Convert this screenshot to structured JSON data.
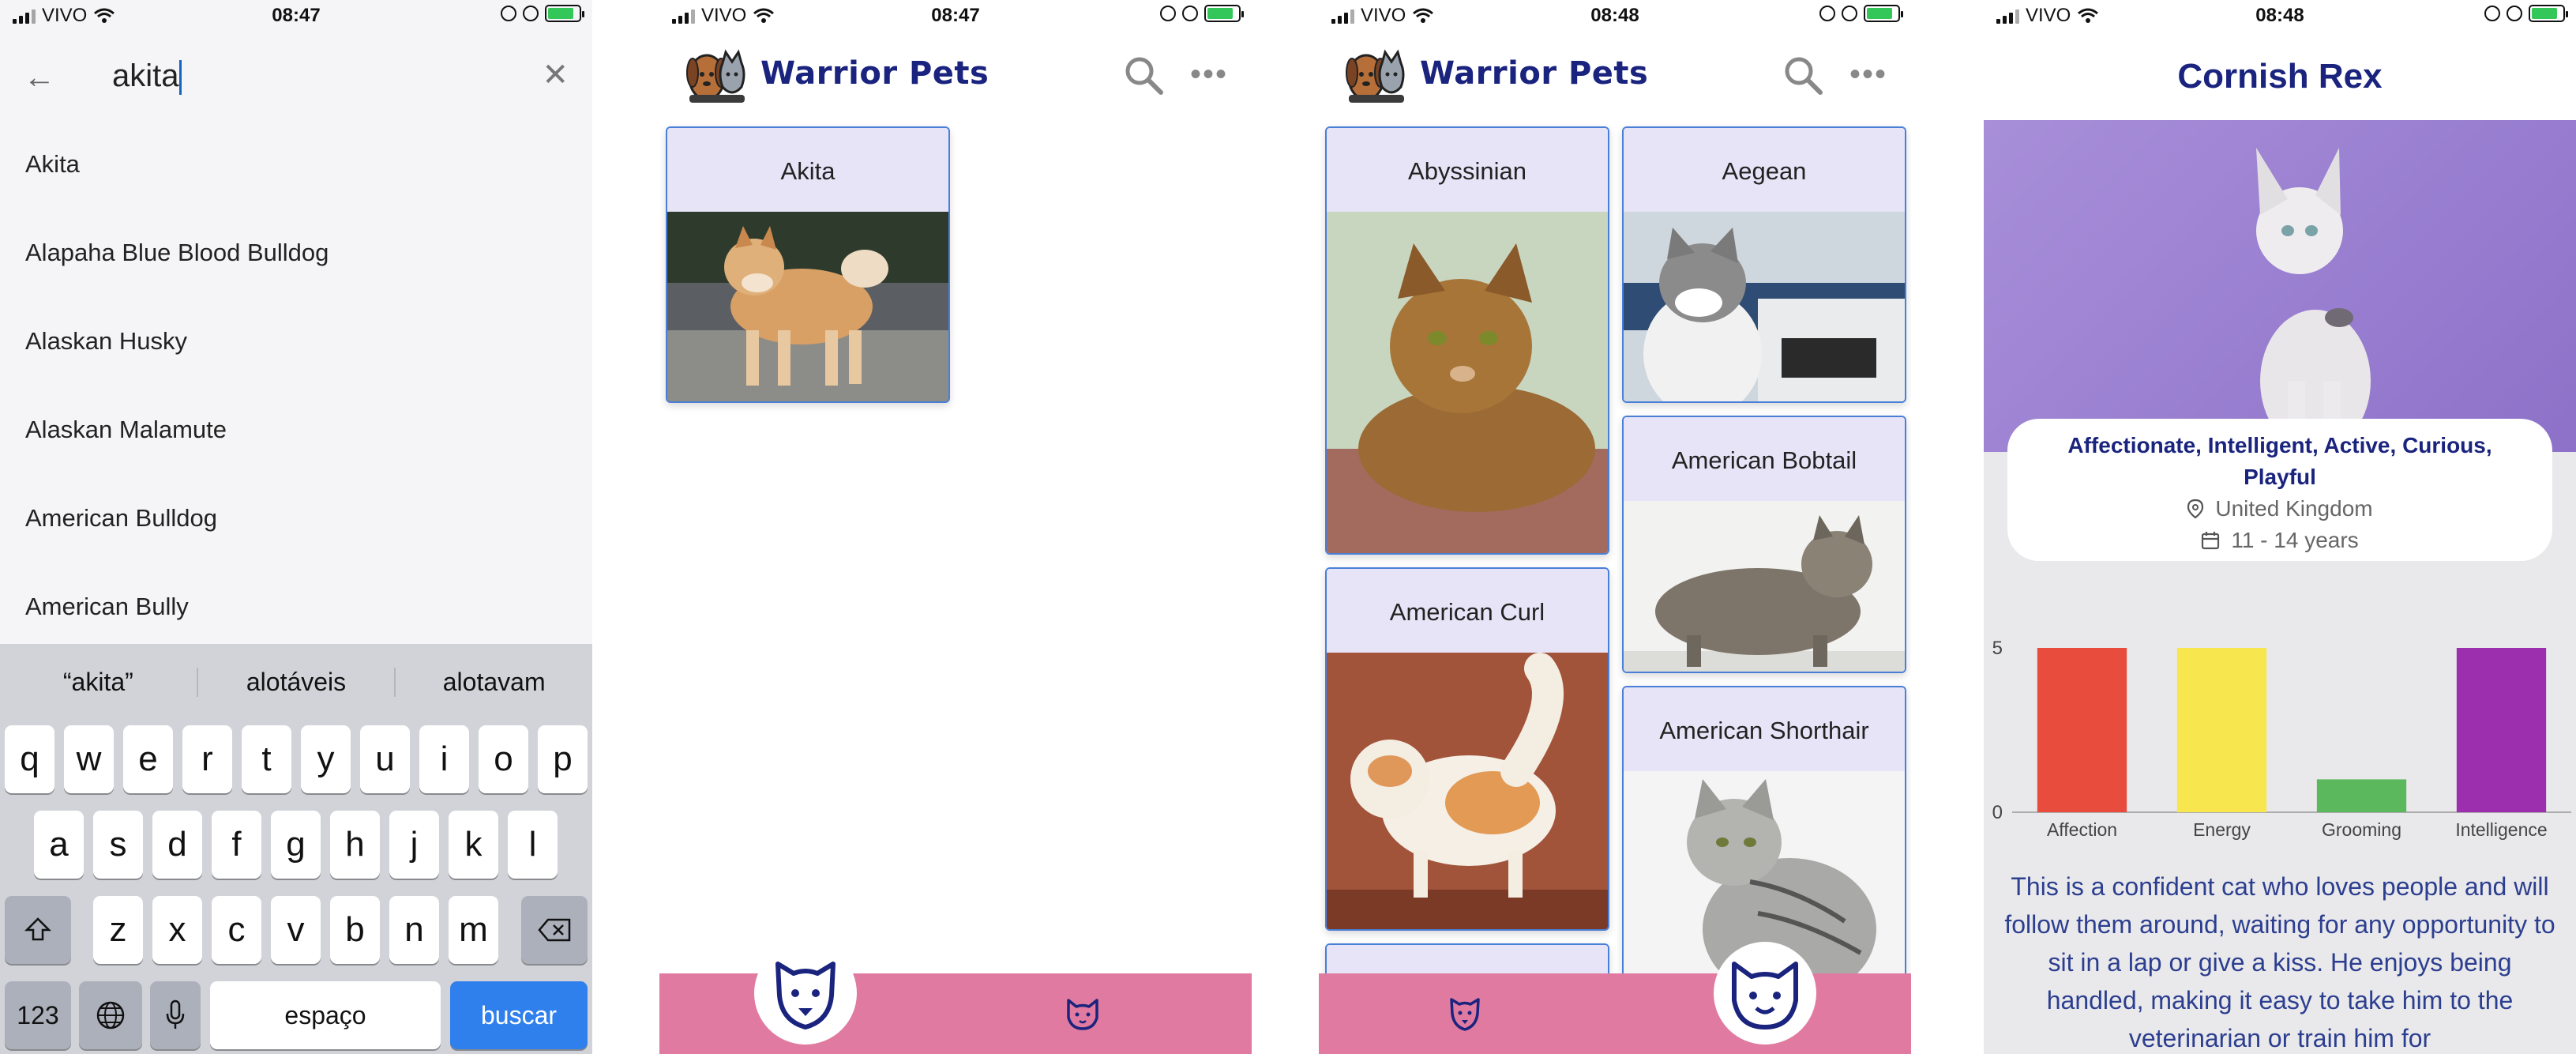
{
  "status": {
    "carrier": "VIVO",
    "times": [
      "08:47",
      "08:47",
      "08:48",
      "08:48"
    ]
  },
  "search_screen": {
    "query": "akita",
    "suggestions": [
      "Akita",
      "Alapaha Blue Blood Bulldog",
      "Alaskan Husky",
      "Alaskan Malamute",
      "American Bulldog",
      "American Bully"
    ],
    "predictions": [
      "“akita”",
      "alotáveis",
      "alotavam"
    ],
    "keyboard": {
      "row1": [
        "q",
        "w",
        "e",
        "r",
        "t",
        "y",
        "u",
        "i",
        "o",
        "p"
      ],
      "row2": [
        "a",
        "s",
        "d",
        "f",
        "g",
        "h",
        "j",
        "k",
        "l"
      ],
      "row3": [
        "z",
        "x",
        "c",
        "v",
        "b",
        "n",
        "m"
      ],
      "numbers": "123",
      "space": "espaço",
      "search": "buscar"
    }
  },
  "app": {
    "brand": "Warrior Pets",
    "nav_color": "#e07aa0",
    "accent": "#1a237e"
  },
  "dog_results": {
    "cards": [
      "Akita"
    ]
  },
  "cat_list": {
    "cards": [
      "Abyssinian",
      "Aegean",
      "American Bobtail",
      "American Curl",
      "American Shorthair"
    ]
  },
  "detail": {
    "breed": "Cornish Rex",
    "temperament": "Affectionate, Intelligent, Active, Curious, Playful",
    "origin": "United Kingdom",
    "life_span": "11 - 14 years",
    "description": "This is a confident cat who loves people and will follow them around, waiting for any opportunity to sit in a lap or give a kiss. He enjoys being handled, making it easy to take him to the veterinarian or train him for"
  },
  "chart_data": {
    "type": "bar",
    "categories": [
      "Affection",
      "Energy",
      "Grooming",
      "Intelligence"
    ],
    "values": [
      5,
      5,
      1,
      5
    ],
    "colors": [
      "#e74c3c",
      "#f8e64f",
      "#5cb85c",
      "#9b2fae"
    ],
    "yticks": [
      0,
      5
    ],
    "ylim": [
      0,
      5
    ],
    "title": "",
    "xlabel": "",
    "ylabel": ""
  }
}
